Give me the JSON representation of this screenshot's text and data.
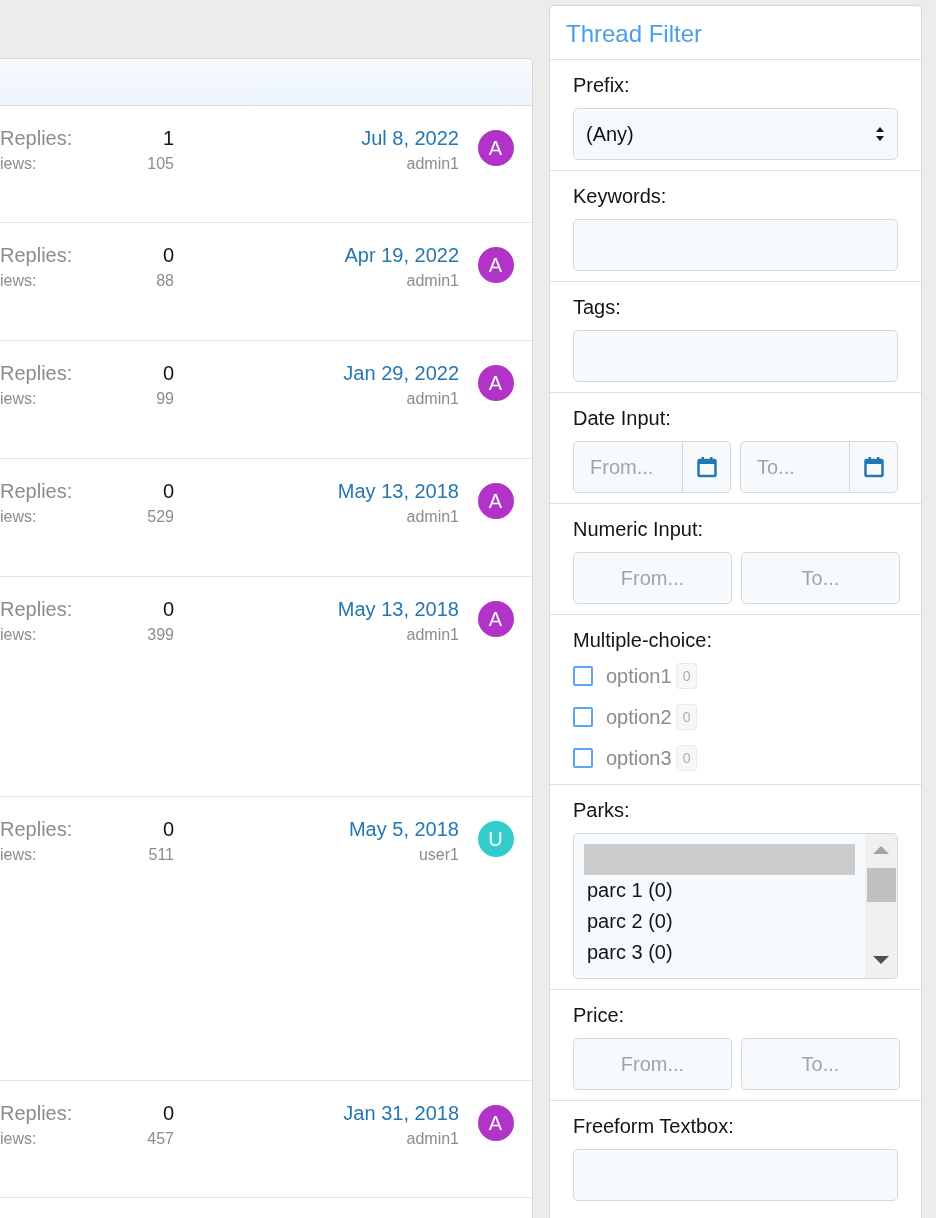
{
  "threads": [
    {
      "replies_label": "Replies:",
      "replies": "1",
      "views_label": "iews:",
      "views": "105",
      "date": "Jul 8, 2022",
      "author": "admin1",
      "avatar": "A",
      "color": "#b133c8"
    },
    {
      "replies_label": "Replies:",
      "replies": "0",
      "views_label": "iews:",
      "views": "88",
      "date": "Apr 19, 2022",
      "author": "admin1",
      "avatar": "A",
      "color": "#b133c8"
    },
    {
      "replies_label": "Replies:",
      "replies": "0",
      "views_label": "iews:",
      "views": "99",
      "date": "Jan 29, 2022",
      "author": "admin1",
      "avatar": "A",
      "color": "#b133c8"
    },
    {
      "replies_label": "Replies:",
      "replies": "0",
      "views_label": "iews:",
      "views": "529",
      "date": "May 13, 2018",
      "author": "admin1",
      "avatar": "A",
      "color": "#b133c8"
    },
    {
      "replies_label": "Replies:",
      "replies": "0",
      "views_label": "iews:",
      "views": "399",
      "date": "May 13, 2018",
      "author": "admin1",
      "avatar": "A",
      "color": "#b133c8"
    },
    {
      "replies_label": "Replies:",
      "replies": "0",
      "views_label": "iews:",
      "views": "511",
      "date": "May 5, 2018",
      "author": "user1",
      "avatar": "U",
      "color": "#33cccc"
    },
    {
      "replies_label": "Replies:",
      "replies": "0",
      "views_label": "iews:",
      "views": "457",
      "date": "Jan 31, 2018",
      "author": "admin1",
      "avatar": "A",
      "color": "#b133c8"
    }
  ],
  "filter": {
    "title": "Thread Filter",
    "fields": [
      {
        "kind": "select",
        "label": "Prefix:",
        "value": "(Any)"
      },
      {
        "kind": "text",
        "label": "Keywords:"
      },
      {
        "kind": "text",
        "label": "Tags:"
      },
      {
        "kind": "date_range",
        "label": "Date Input:",
        "from": {
          "placeholder": "From..."
        },
        "to": {
          "placeholder": "To..."
        }
      },
      {
        "kind": "range",
        "label": "Numeric Input:",
        "from": {
          "placeholder": "From..."
        },
        "to": {
          "placeholder": "To..."
        }
      },
      {
        "kind": "checkboxes",
        "label": "Multiple-choice:",
        "options": [
          {
            "label": "option1",
            "count": "0",
            "checked": false
          },
          {
            "label": "option2",
            "count": "0",
            "checked": false
          },
          {
            "label": "option3",
            "count": "0",
            "checked": false
          }
        ]
      },
      {
        "kind": "listbox",
        "label": "Parks:",
        "empty_option_selected": true,
        "options": [
          {
            "label": "parc 1 (0)",
            "selected": false
          },
          {
            "label": "parc 2 (0)",
            "selected": false
          },
          {
            "label": "parc 3 (0)",
            "selected": false
          }
        ]
      },
      {
        "kind": "range",
        "label": "Price:",
        "from": {
          "placeholder": "From..."
        },
        "to": {
          "placeholder": "To..."
        }
      },
      {
        "kind": "text",
        "label": "Freeform Textbox:"
      }
    ]
  }
}
